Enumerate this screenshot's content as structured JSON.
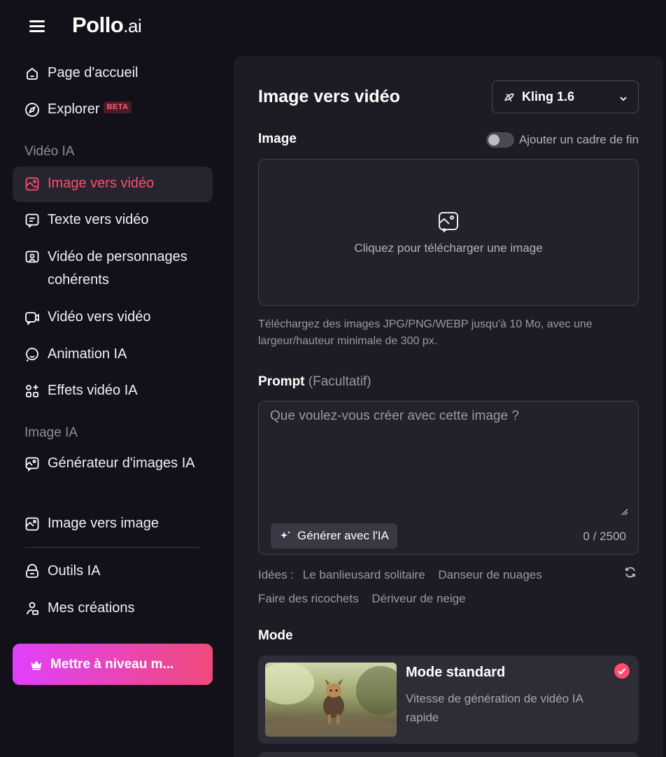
{
  "app": {
    "logo_main": "Pollo",
    "logo_suffix": ".ai"
  },
  "sidebar": {
    "items": [
      {
        "label": "Page d'accueil",
        "icon": "home-icon"
      },
      {
        "label": "Explorer",
        "icon": "compass-icon",
        "badge": "BETA"
      }
    ],
    "section_video": "Vidéo IA",
    "video_items": [
      {
        "label": "Image vers vidéo",
        "icon": "image-to-video-icon",
        "active": true
      },
      {
        "label": "Texte vers vidéo",
        "icon": "text-to-video-icon"
      },
      {
        "label": "Vidéo de personnages cohérents",
        "icon": "character-video-icon"
      },
      {
        "label": "Vidéo vers vidéo",
        "icon": "video-to-video-icon"
      },
      {
        "label": "Animation IA",
        "icon": "animation-icon"
      },
      {
        "label": "Effets vidéo IA",
        "icon": "effects-icon"
      }
    ],
    "section_image": "Image IA",
    "image_items": [
      {
        "label": "Générateur d'images IA",
        "icon": "image-generator-icon"
      },
      {
        "label": "Image vers image",
        "icon": "image-to-image-icon"
      }
    ],
    "bottom_items": [
      {
        "label": "Outils IA",
        "icon": "tools-icon"
      },
      {
        "label": "Mes créations",
        "icon": "user-creations-icon"
      }
    ],
    "upgrade_label": "Mettre à niveau m..."
  },
  "main": {
    "title": "Image vers vidéo",
    "model": "Kling 1.6",
    "image_label": "Image",
    "end_frame_toggle": "Ajouter un cadre de fin",
    "upload_text": "Cliquez pour télécharger une image",
    "upload_hint": "Téléchargez des images JPG/PNG/WEBP jusqu'à 10 Mo, avec une largeur/hauteur minimale de 300 px.",
    "prompt_label": "Prompt",
    "prompt_optional": "(Facultatif)",
    "prompt_placeholder": "Que voulez-vous créer avec cette image ?",
    "generate_label": "Générer avec l'IA",
    "counter": "0 / 2500",
    "ideas_label": "Idées :",
    "ideas": [
      "Le banlieusard solitaire",
      "Danseur de nuages",
      "Faire des ricochets",
      "Dériveur de neige"
    ],
    "mode_label": "Mode",
    "mode": {
      "title": "Mode standard",
      "description": "Vitesse de génération de vidéo IA rapide"
    }
  },
  "colors": {
    "accent": "#ff4d6d",
    "background": "#121119",
    "panel": "#1d1c24"
  }
}
